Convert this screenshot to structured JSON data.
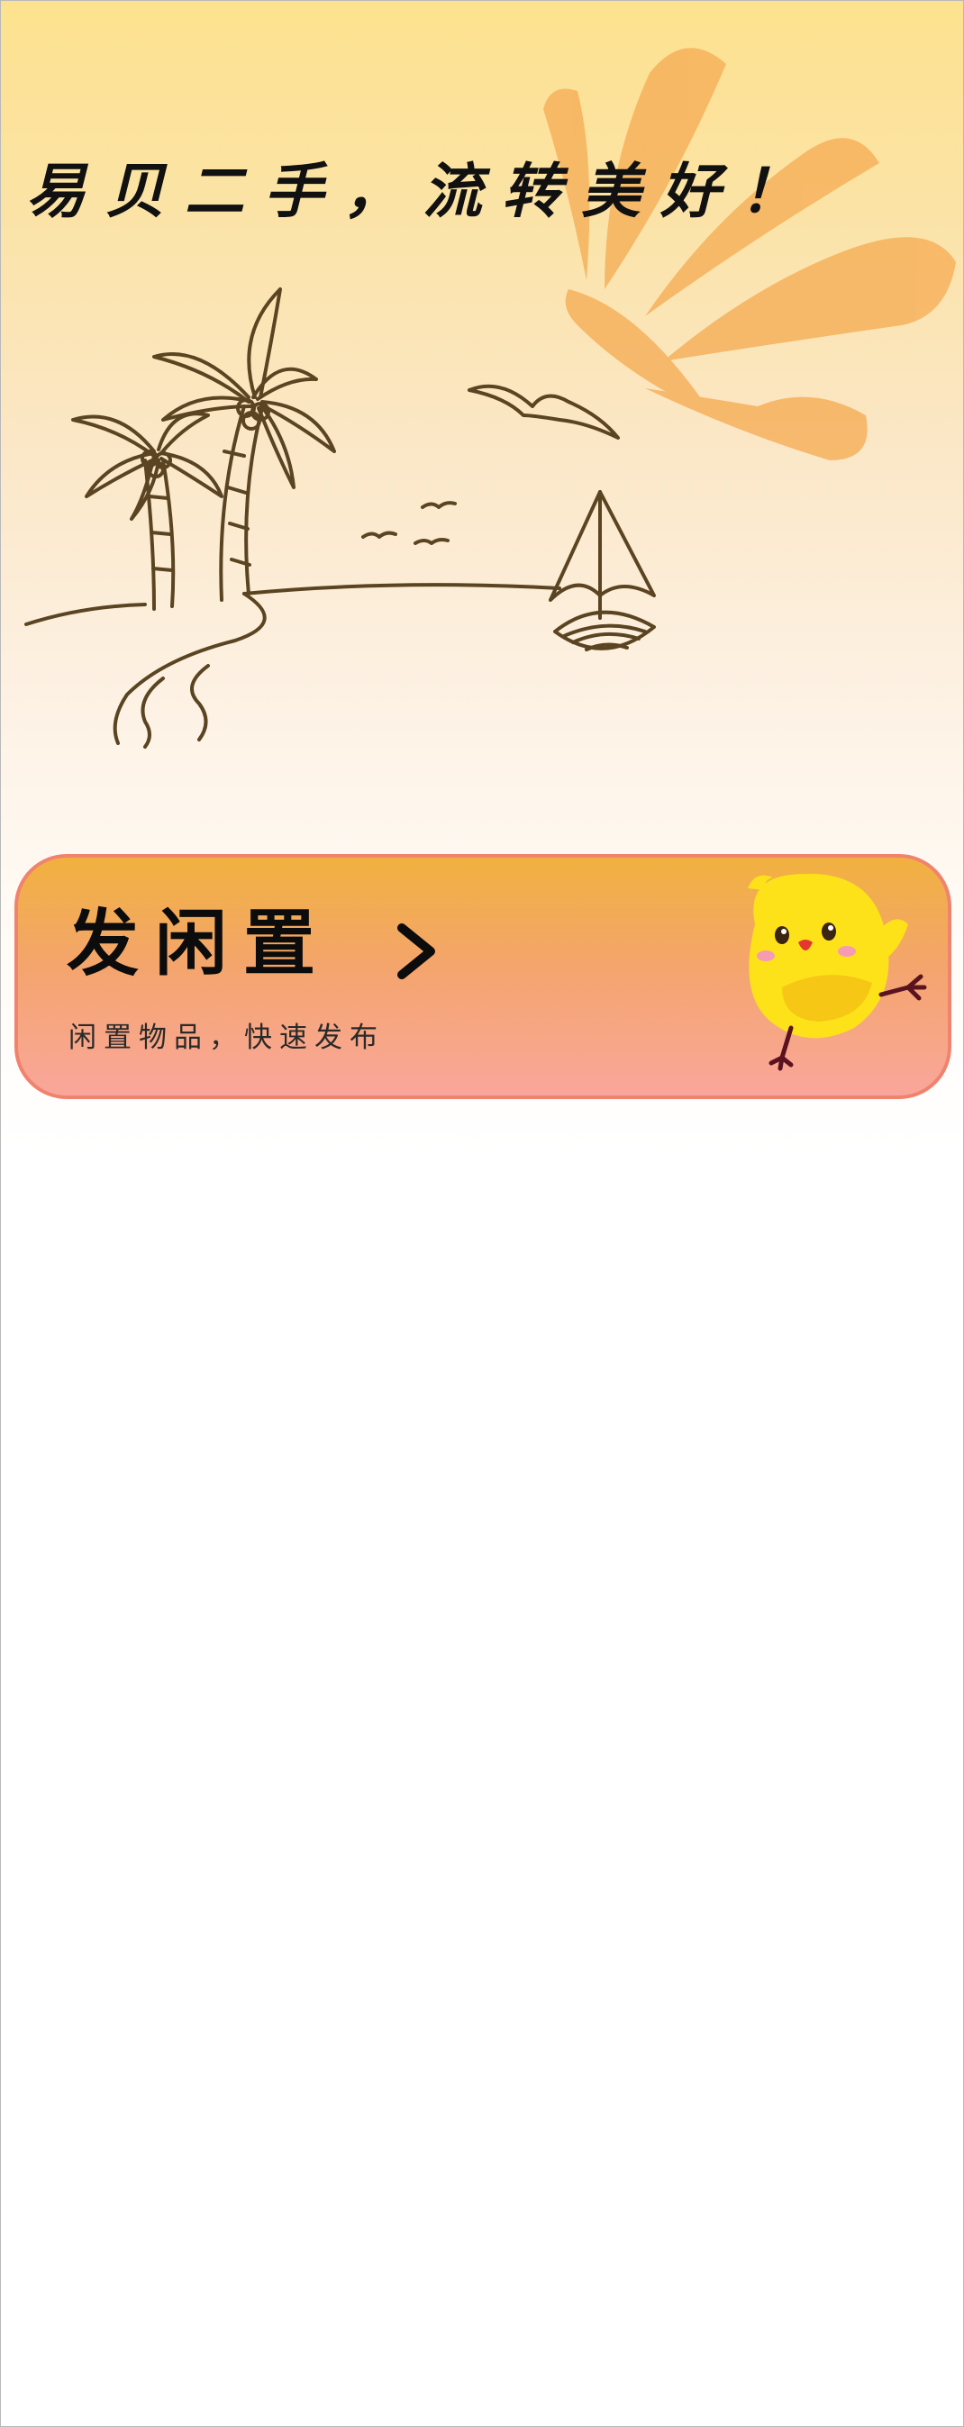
{
  "hero": {
    "slogan": "易贝二手，流转美好！"
  },
  "publish_card": {
    "title": "发闲置",
    "subtitle": "闲置物品，快速发布",
    "arrow_icon": "chevron-right-icon",
    "mascot": "yellow-chick-mascot"
  },
  "colors": {
    "hero_top": "#fde28e",
    "sun": "#f6b05a",
    "card_top": "#f1b13f",
    "card_bottom": "#f9a69b",
    "card_border": "#f0836e"
  }
}
